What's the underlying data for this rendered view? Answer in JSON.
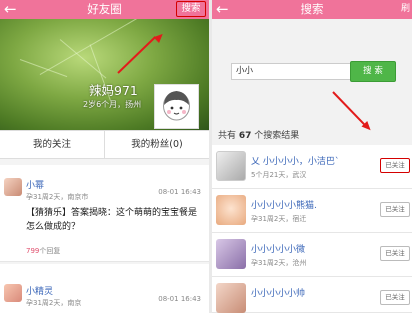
{
  "left": {
    "header": {
      "title": "好友圈",
      "search_label": "搜索"
    },
    "profile": {
      "name": "辣妈971",
      "sub": "2岁6个月，扬州"
    },
    "tabs": [
      "我的关注",
      "我的粉丝(0)"
    ],
    "posts": [
      {
        "author": "小幂",
        "meta": "孕31周2天，南京市",
        "time": "08-01 16:43",
        "body": "【猜猜乐】答案揭晓：这个萌萌的宝宝餐是怎么做成的？",
        "reply_count": "799",
        "reply_suffix": "个回复"
      },
      {
        "author": "小精灵",
        "meta": "孕31周2天，南京",
        "time": "08-01 16:43"
      }
    ],
    "colors": {
      "header": "#f0739a",
      "annotation": "#e21b1b"
    }
  },
  "right": {
    "header": {
      "title": "搜索",
      "refresh_label": "刷"
    },
    "search": {
      "value": "小小",
      "button_label": "搜 索"
    },
    "result_summary": {
      "prefix": "共有",
      "count": "67",
      "suffix": "个搜索结果"
    },
    "results": [
      {
        "name": "乂 小小小小，小洁巴`",
        "meta": "5个月21天，武汉",
        "status": "已关注",
        "highlighted": true
      },
      {
        "name": "小小小小小熊猫.",
        "meta": "孕31周2天，宿迁",
        "status": "已关注",
        "highlighted": false
      },
      {
        "name": "小小小小小微",
        "meta": "孕31周2天，沧州",
        "status": "已关注",
        "highlighted": false
      },
      {
        "name": "小小小小小帅",
        "meta": "",
        "status": "已关注",
        "highlighted": false
      }
    ]
  }
}
